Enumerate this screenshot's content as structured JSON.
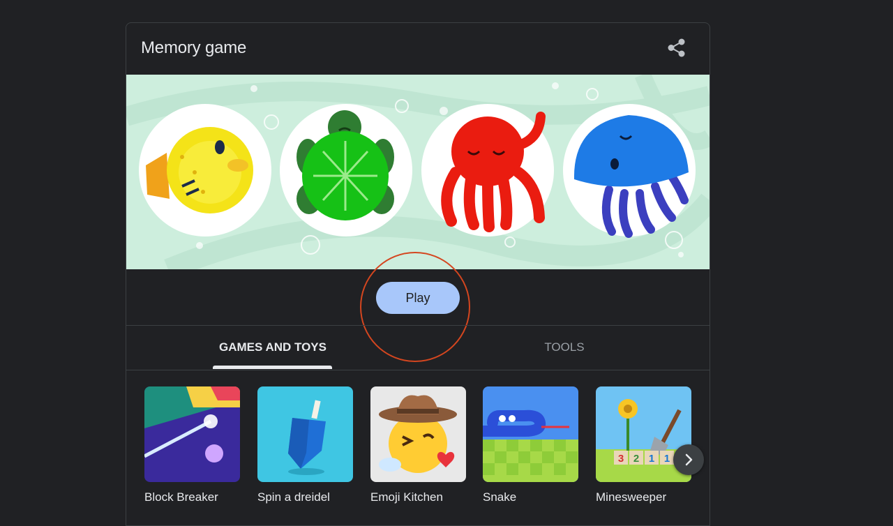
{
  "card": {
    "title": "Memory game",
    "share_icon": "share-icon"
  },
  "banner": {
    "characters": [
      "pufferfish",
      "turtle",
      "octopus",
      "jellyfish"
    ]
  },
  "play_button": {
    "label": "Play"
  },
  "tabs": [
    {
      "label": "GAMES AND TOYS",
      "active": true
    },
    {
      "label": "TOOLS",
      "active": false
    }
  ],
  "games": [
    {
      "label": "Block Breaker"
    },
    {
      "label": "Spin a dreidel"
    },
    {
      "label": "Emoji Kitchen"
    },
    {
      "label": "Snake"
    },
    {
      "label": "Minesweeper"
    }
  ],
  "minesweeper_numbers": [
    "3",
    "2",
    "1",
    "1"
  ],
  "colors": {
    "background": "#202124",
    "play_button": "#a8c7fa",
    "annotation_circle": "#d4461f",
    "banner": "#cdeedd"
  }
}
